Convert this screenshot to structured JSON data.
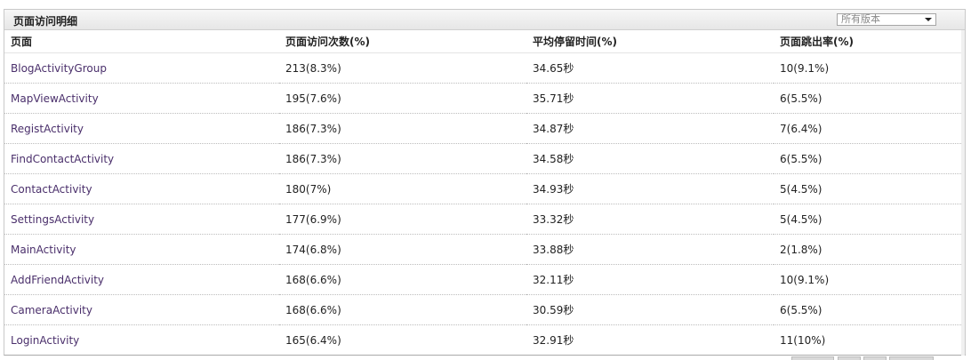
{
  "panel": {
    "title": "页面访问明细",
    "version_select": {
      "value": "所有版本"
    }
  },
  "table": {
    "headers": [
      "页面",
      "页面访问次数(%)",
      "平均停留时间(%)",
      "页面跳出率(%)"
    ],
    "rows": [
      {
        "page": "BlogActivityGroup",
        "visits": "213(8.3%)",
        "avg_time": "34.65秒",
        "bounce": "10(9.1%)"
      },
      {
        "page": "MapViewActivity",
        "visits": "195(7.6%)",
        "avg_time": "35.71秒",
        "bounce": "6(5.5%)"
      },
      {
        "page": "RegistActivity",
        "visits": "186(7.3%)",
        "avg_time": "34.87秒",
        "bounce": "7(6.4%)"
      },
      {
        "page": "FindContactActivity",
        "visits": "186(7.3%)",
        "avg_time": "34.58秒",
        "bounce": "6(5.5%)"
      },
      {
        "page": "ContactActivity",
        "visits": "180(7%)",
        "avg_time": "34.93秒",
        "bounce": "5(4.5%)"
      },
      {
        "page": "SettingsActivity",
        "visits": "177(6.9%)",
        "avg_time": "33.32秒",
        "bounce": "5(4.5%)"
      },
      {
        "page": "MainActivity",
        "visits": "174(6.8%)",
        "avg_time": "33.88秒",
        "bounce": "2(1.8%)"
      },
      {
        "page": "AddFriendActivity",
        "visits": "168(6.6%)",
        "avg_time": "32.11秒",
        "bounce": "10(9.1%)"
      },
      {
        "page": "CameraActivity",
        "visits": "168(6.6%)",
        "avg_time": "30.59秒",
        "bounce": "6(5.5%)"
      },
      {
        "page": "LoginActivity",
        "visits": "165(6.4%)",
        "avg_time": "32.91秒",
        "bounce": "11(10%)"
      }
    ]
  },
  "colors": {
    "link": "#4a2f6b",
    "header_bg": "#ececec",
    "border": "#c9c9c9"
  }
}
